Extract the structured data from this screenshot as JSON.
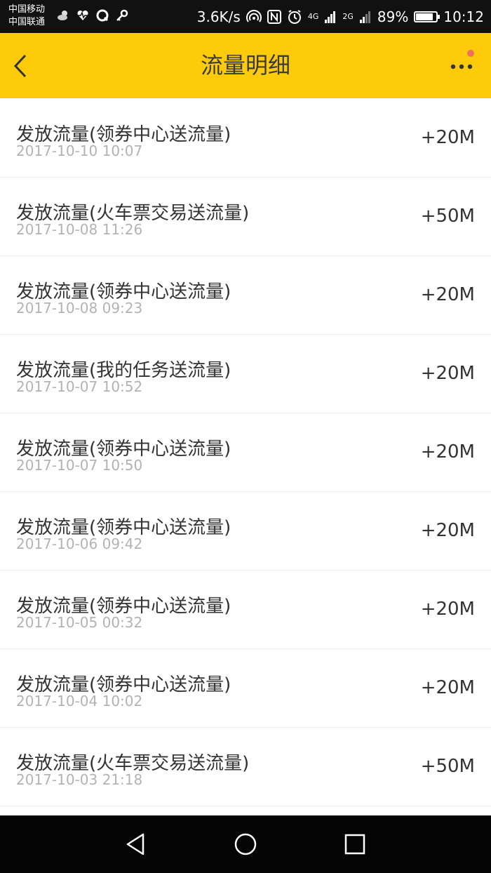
{
  "status_bar": {
    "carrier_1": "中国移动",
    "carrier_2": "中国联通",
    "speed": "3.6K/s",
    "network_1": "4G",
    "network_2": "2G",
    "battery": "89%",
    "battery_level": 0.89,
    "time": "10:12"
  },
  "header": {
    "title": "流量明细",
    "accent_color": "#FECB0B",
    "notification_dot_color": "#F06E5D"
  },
  "records": [
    {
      "title": "发放流量(领券中心送流量)",
      "time": "2017-10-10 10:07",
      "amount": "+20M"
    },
    {
      "title": "发放流量(火车票交易送流量)",
      "time": "2017-10-08 11:26",
      "amount": "+50M"
    },
    {
      "title": "发放流量(领券中心送流量)",
      "time": "2017-10-08 09:23",
      "amount": "+20M"
    },
    {
      "title": "发放流量(我的任务送流量)",
      "time": "2017-10-07 10:52",
      "amount": "+20M"
    },
    {
      "title": "发放流量(领券中心送流量)",
      "time": "2017-10-07 10:50",
      "amount": "+20M"
    },
    {
      "title": "发放流量(领券中心送流量)",
      "time": "2017-10-06 09:42",
      "amount": "+20M"
    },
    {
      "title": "发放流量(领券中心送流量)",
      "time": "2017-10-05 00:32",
      "amount": "+20M"
    },
    {
      "title": "发放流量(领券中心送流量)",
      "time": "2017-10-04 10:02",
      "amount": "+20M"
    },
    {
      "title": "发放流量(火车票交易送流量)",
      "time": "2017-10-03 21:18",
      "amount": "+50M"
    }
  ],
  "icons": {
    "back": "back-chevron-icon",
    "more": "more-dots-icon",
    "nav_back": "triangle-back-icon",
    "nav_home": "circle-home-icon",
    "nav_recent": "square-recent-icon"
  }
}
